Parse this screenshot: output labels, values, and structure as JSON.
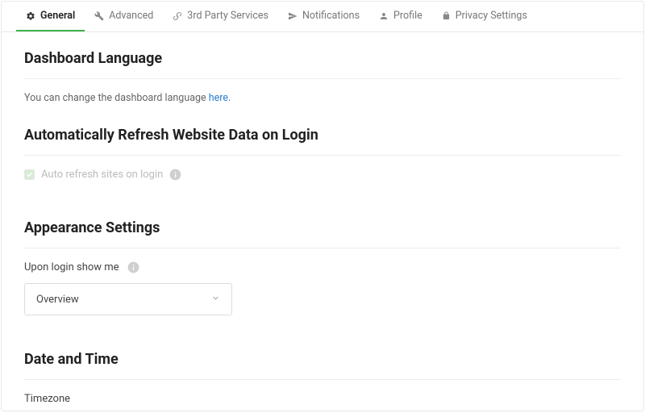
{
  "tabs": {
    "general": "General",
    "advanced": "Advanced",
    "services": "3rd Party Services",
    "notifications": "Notifications",
    "profile": "Profile",
    "privacy": "Privacy Settings"
  },
  "sections": {
    "dashboard_language": {
      "title": "Dashboard Language",
      "text_prefix": "You can change the dashboard language ",
      "link_text": "here",
      "text_suffix": "."
    },
    "auto_refresh": {
      "title": "Automatically Refresh Website Data on Login",
      "checkbox_label": "Auto refresh sites on login"
    },
    "appearance": {
      "title": "Appearance Settings",
      "field_label": "Upon login show me",
      "selected_option": "Overview"
    },
    "date_time": {
      "title": "Date and Time",
      "field_label": "Timezone"
    }
  }
}
